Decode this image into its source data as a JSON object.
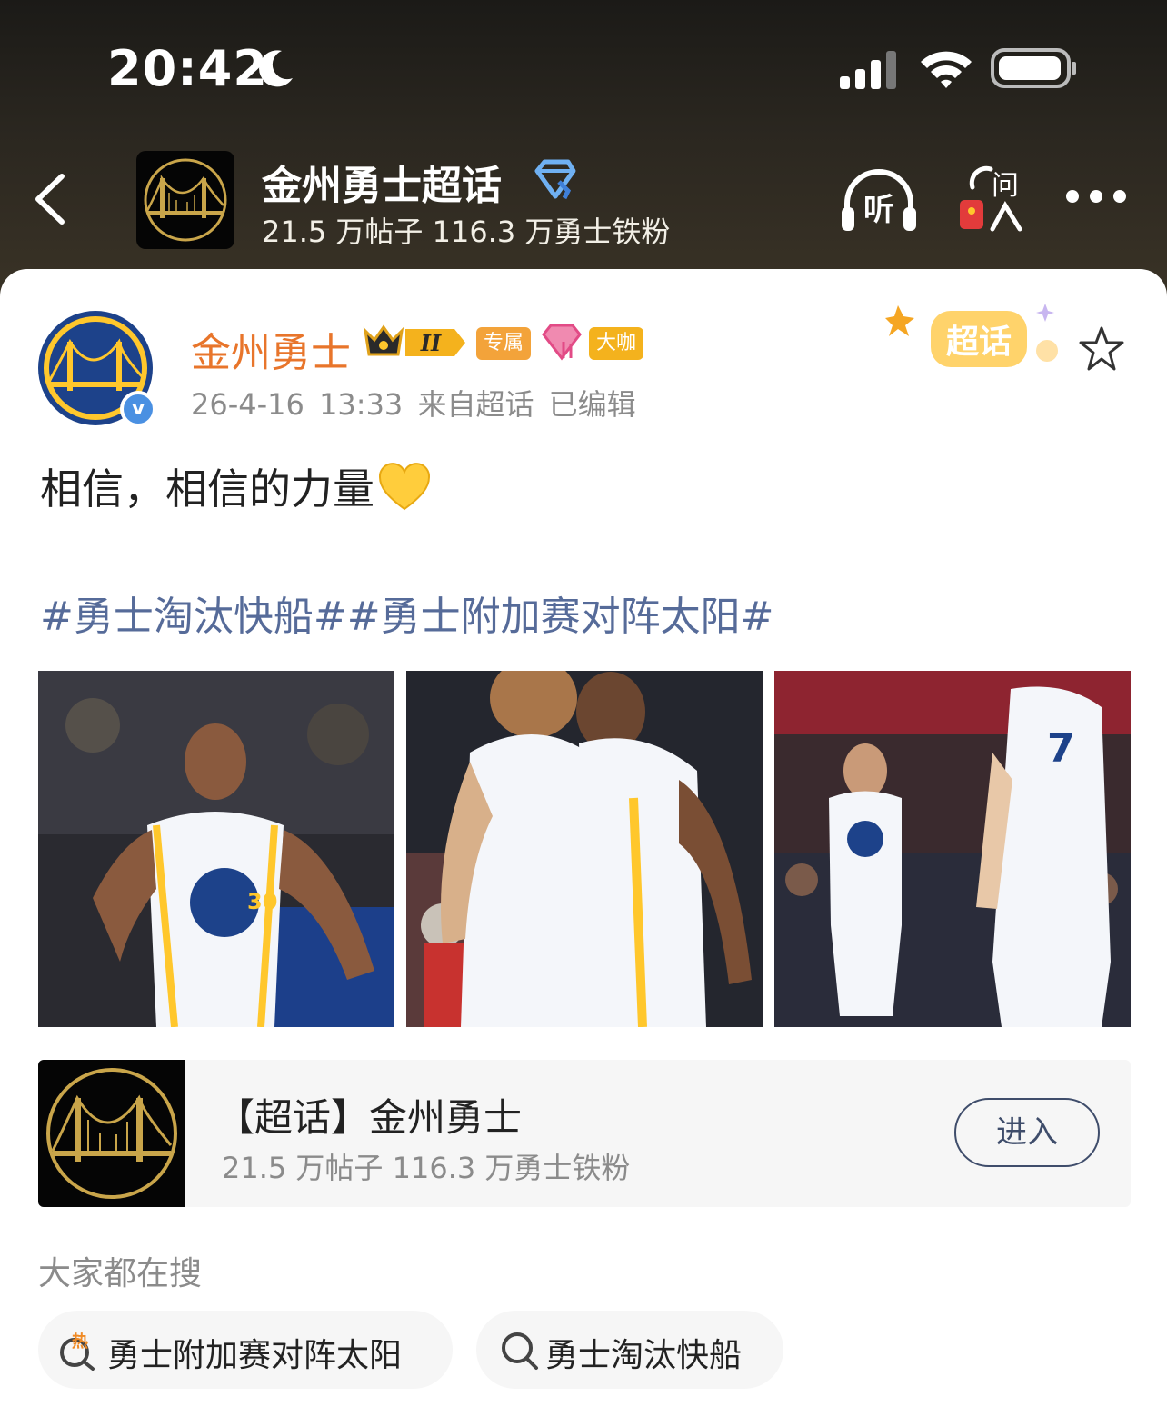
{
  "status_bar": {
    "time": "20:42",
    "icons": [
      "moon-icon",
      "signal-icon",
      "wifi-icon",
      "battery-icon"
    ]
  },
  "header": {
    "title": "金州勇士超话",
    "subtitle": "21.5 万帖子 116.3 万勇士铁粉",
    "listen_label": "听",
    "ask_label": "问",
    "icons": [
      "back-icon",
      "diamond-icon",
      "listen-icon",
      "ask-icon",
      "more-icon"
    ]
  },
  "post": {
    "author": "金州勇士",
    "crown_level": "II",
    "badge_exclusive": "专属",
    "badge_vip": "大咖",
    "meta": "26-4-16 13:33  来自超话  已编辑",
    "sticker_text": "超话",
    "text": "相信，相信的力量",
    "hashtags": [
      "#勇士淘汰快船#",
      "#勇士附加赛对阵太阳#"
    ],
    "photos": [
      {
        "jersey_number": "30",
        "kind": "player-photo"
      },
      {
        "kind": "player-photo"
      },
      {
        "jersey_number": "7",
        "kind": "player-photo"
      }
    ]
  },
  "topic_card": {
    "title": "【超话】金州勇士",
    "subtitle": "21.5 万帖子 116.3 万勇士铁粉",
    "button": "进入"
  },
  "search": {
    "heading": "大家都在搜",
    "hot_badge": "热",
    "chips": [
      {
        "label": "勇士附加赛对阵太阳",
        "icon": "hot-search-icon"
      },
      {
        "label": "勇士淘汰快船",
        "icon": "search-icon"
      }
    ]
  },
  "colors": {
    "header_bg": "#2b2720",
    "author": "#e8752b",
    "hashtag": "#566b99",
    "meta": "#8b8b8b",
    "warriors_blue": "#1d428a",
    "warriors_gold": "#ffc72c"
  }
}
